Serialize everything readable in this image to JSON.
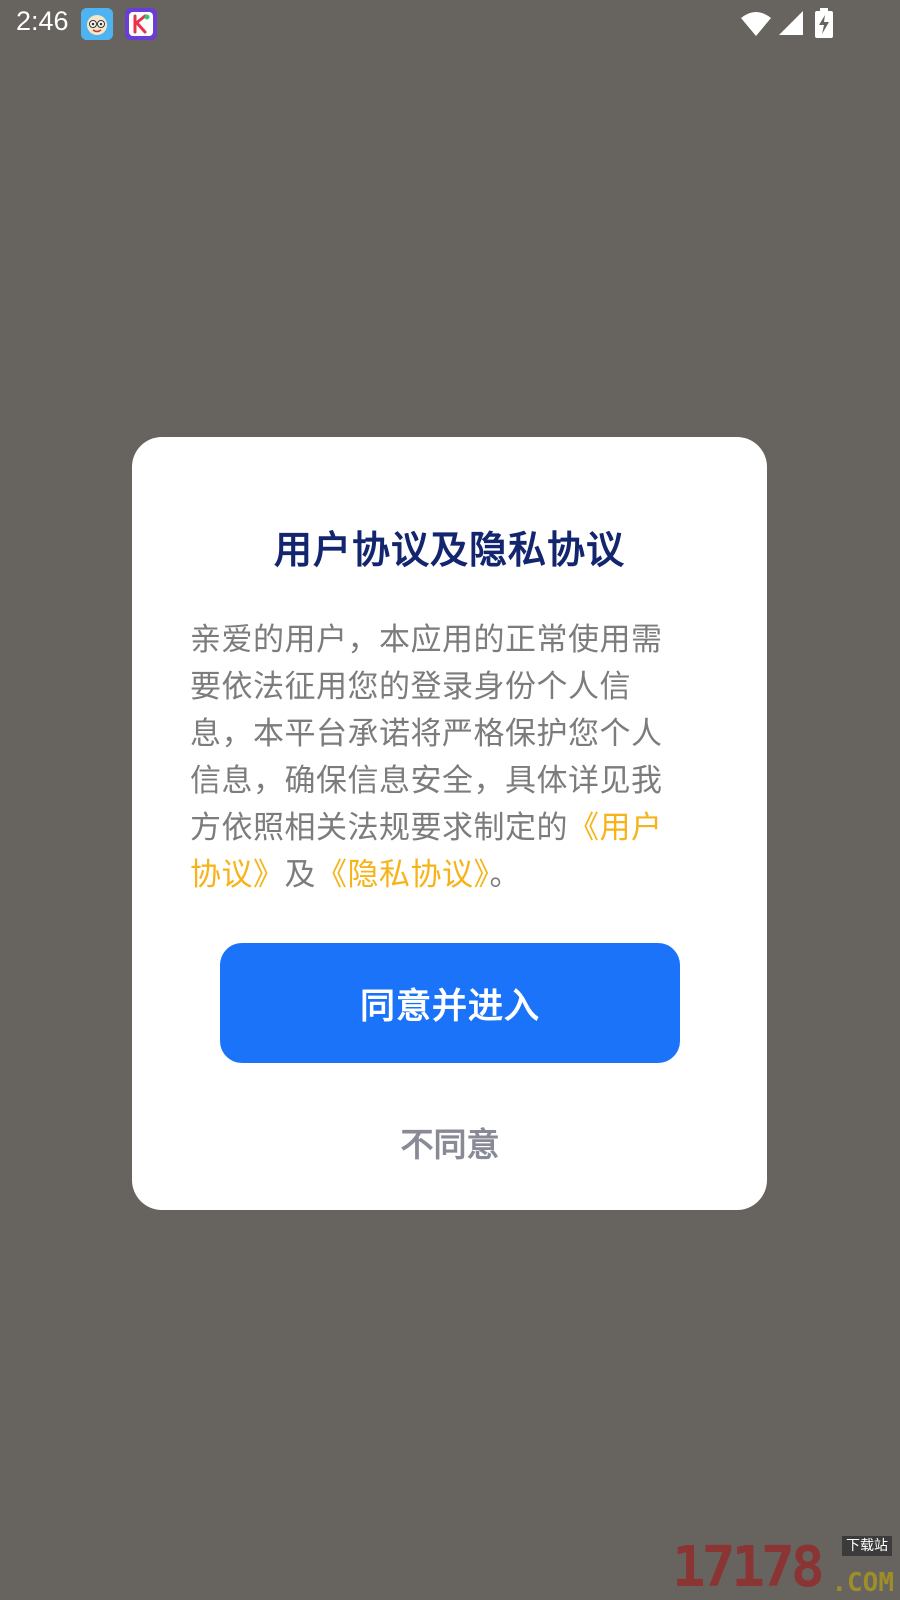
{
  "status_bar": {
    "time": "2:46",
    "notification_icons": [
      "kids-app-icon",
      "k-app-icon"
    ],
    "right_icons": [
      "wifi-icon",
      "cellular-signal-icon",
      "battery-charging-icon"
    ]
  },
  "dialog": {
    "title": "用户协议及隐私协议",
    "body_text": "亲爱的用户，本应用的正常使用需要依法征用您的登录身份个人信息，本平台承诺将严格保护您个人信息，确保信息安全，具体详见我方依照相关法规要求制定的",
    "user_agreement_link": "《用户协议》",
    "connector": "及",
    "privacy_link": "《隐私协议》",
    "end_punct": "。",
    "agree_label": "同意并进入",
    "decline_label": "不同意"
  },
  "watermark": {
    "digits": "17178",
    "domain": ".COM",
    "label": "下载站"
  },
  "colors": {
    "overlay": "#67645f",
    "title": "#12256e",
    "link": "#f6b41a",
    "primary_button": "#1a73f8",
    "body_text": "#7c7c7c",
    "decline_text": "#888a96"
  }
}
